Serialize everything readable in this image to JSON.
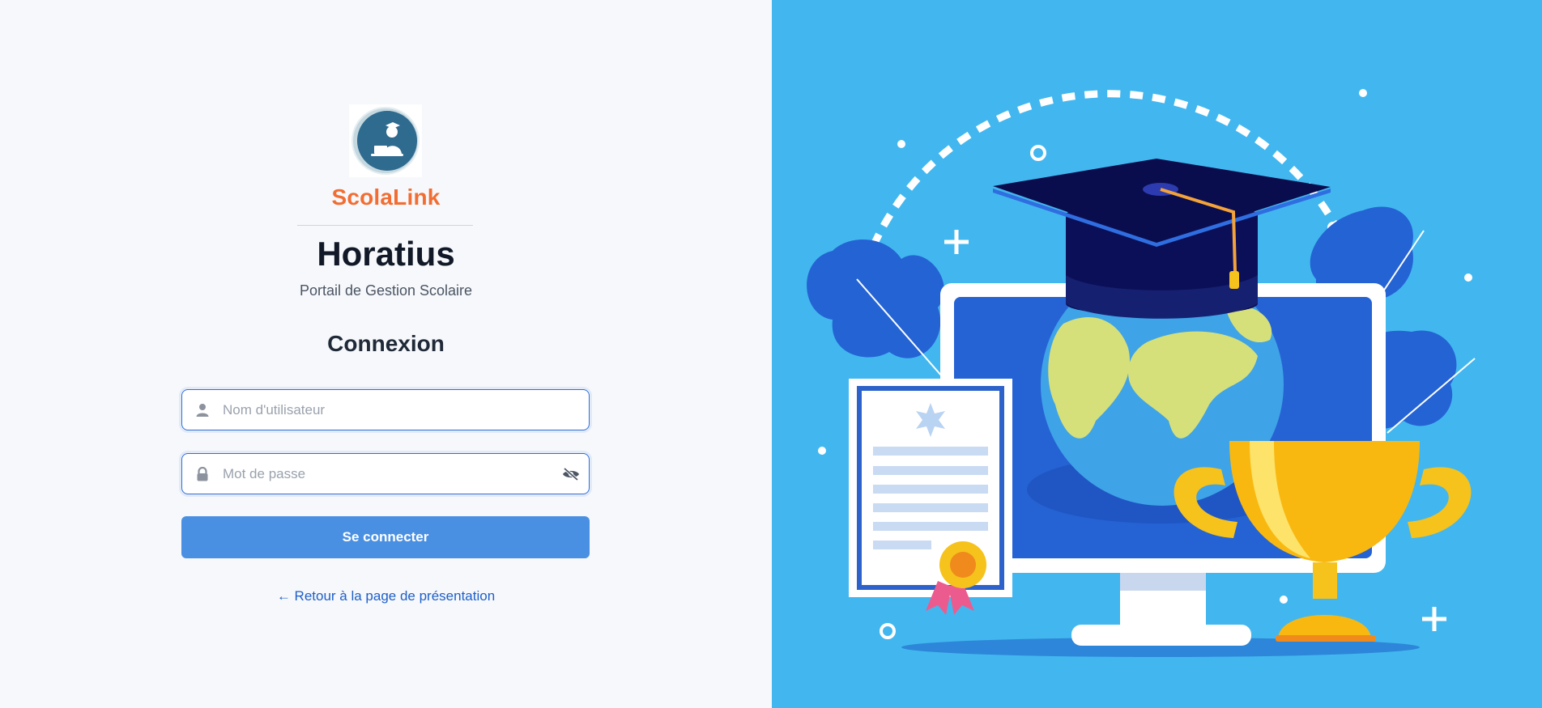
{
  "brand": {
    "name": "ScolaLink",
    "logo_icon": "student-laptop-icon",
    "color": "#f26d32"
  },
  "app": {
    "name": "Horatius",
    "subtitle": "Portail de Gestion Scolaire"
  },
  "login": {
    "title": "Connexion",
    "username": {
      "placeholder": "Nom d'utilisateur",
      "value": "",
      "icon": "user-icon"
    },
    "password": {
      "placeholder": "Mot de passe",
      "value": "",
      "icon": "lock-icon",
      "toggle_icon": "eye-slash-icon"
    },
    "submit_label": "Se connecter",
    "back_link": "← Retour à la page de présentation"
  },
  "illustration": {
    "name": "graduation-illustration",
    "background": "#42b7ef",
    "elements": [
      "graduation-cap",
      "globe",
      "computer-monitor",
      "diploma-certificate",
      "trophy",
      "leaves"
    ]
  },
  "colors": {
    "accent": "#4a90e2",
    "border": "#2f6fd6",
    "link": "#1f5fc9"
  }
}
